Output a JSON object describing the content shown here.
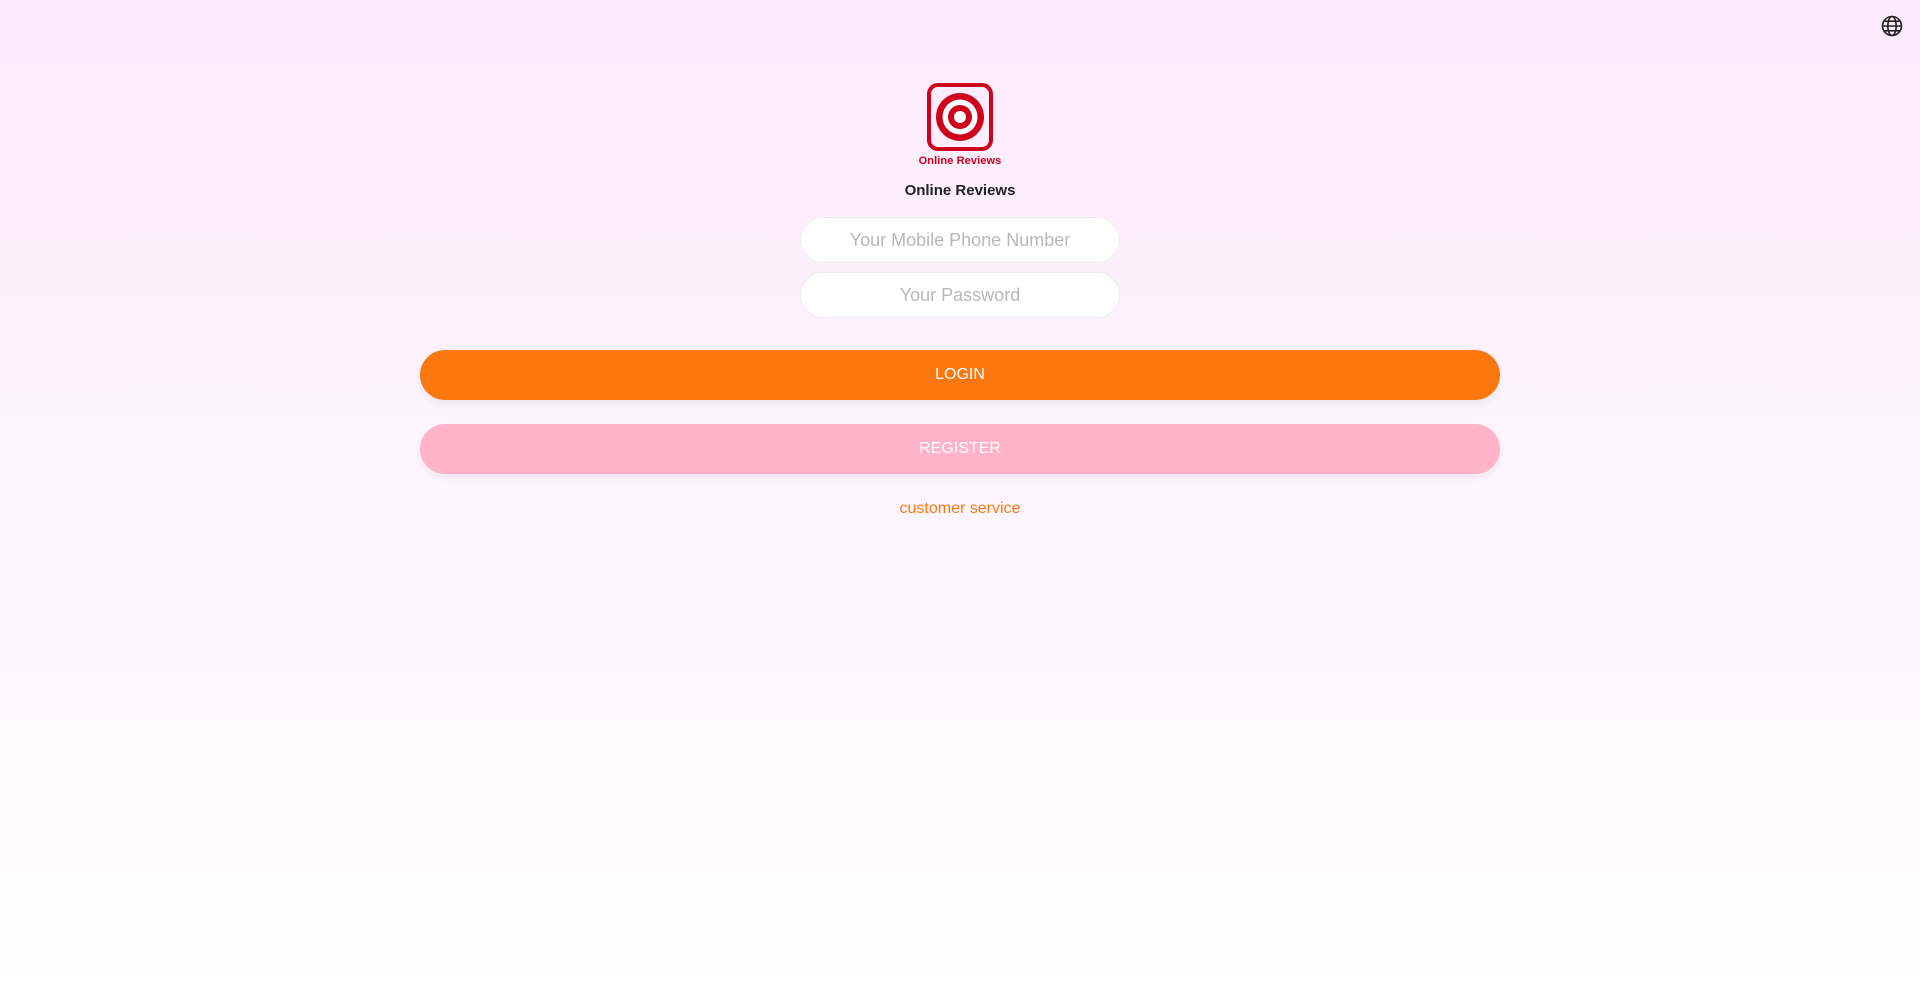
{
  "header": {
    "language_icon": "globe-icon"
  },
  "logo": {
    "icon": "target-icon",
    "text": "Online Reviews",
    "color": "#d0021b"
  },
  "app_name": "Online Reviews",
  "form": {
    "phone_placeholder": "Your Mobile Phone Number",
    "phone_value": "",
    "password_placeholder": "Your Password",
    "password_value": ""
  },
  "buttons": {
    "login_label": "LOGIN",
    "register_label": "REGISTER"
  },
  "links": {
    "customer_service": "customer service"
  },
  "colors": {
    "primary": "#fa780f",
    "secondary": "#ffb2c8",
    "brand": "#d0021b"
  }
}
